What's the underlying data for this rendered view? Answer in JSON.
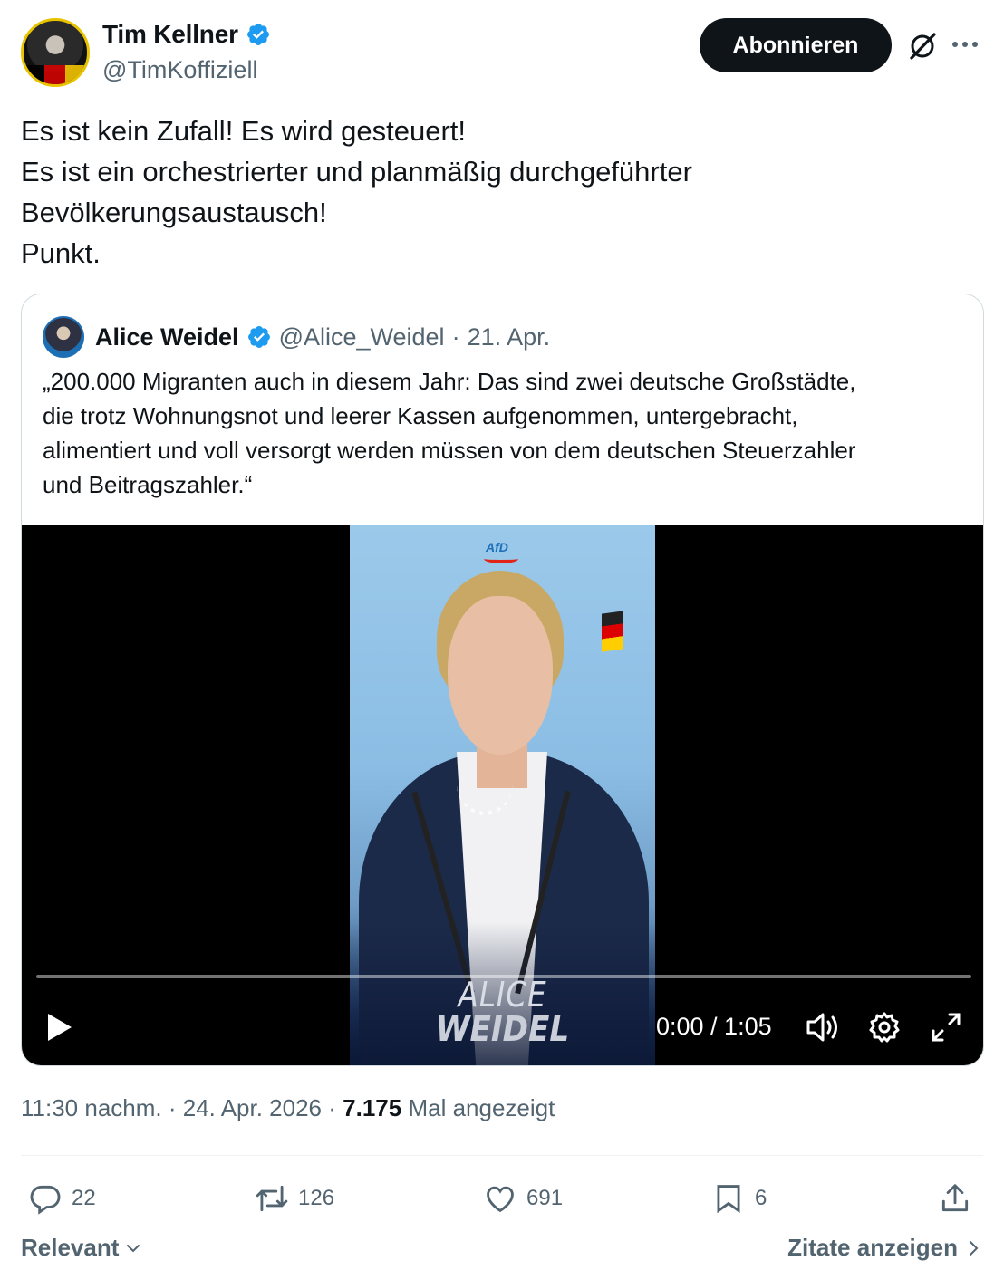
{
  "author": {
    "display_name": "Tim Kellner",
    "handle": "@TimKoffiziell",
    "follow_label": "Abonnieren"
  },
  "tweet": {
    "lines": [
      "Es ist kein Zufall! Es wird gesteuert!",
      "Es ist ein orchestrierter und planmäßig durchgeführter",
      "Bevölkerungsaustausch!",
      "Punkt."
    ]
  },
  "quote": {
    "display_name": "Alice Weidel",
    "handle": "@Alice_Weidel",
    "separator": "·",
    "date": "21. Apr.",
    "lines": [
      "„200.000 Migranten auch in diesem Jahr: Das sind zwei deutsche Großstädte,",
      "die trotz Wohnungsnot und leerer Kassen aufgenommen, untergebracht,",
      "alimentiert und voll versorgt werden müssen von dem deutschen Steuerzahler",
      "und Beitragszahler.“"
    ],
    "video": {
      "logo_text": "AfD",
      "caption_line1": "ALICE",
      "caption_line2": "WEIDEL",
      "time": "0:00 / 1:05",
      "progress": 0
    }
  },
  "meta": {
    "time": "11:30 nachm.",
    "date": "24. Apr. 2026",
    "separator": "·",
    "views_count": "7.175",
    "views_label": "Mal angezeigt"
  },
  "actions": {
    "replies": "22",
    "reposts": "126",
    "likes": "691",
    "bookmarks": "6"
  },
  "footer": {
    "sort_label": "Relevant",
    "quotes_label": "Zitate anzeigen"
  },
  "colors": {
    "verified": "#1d9bf0",
    "text_primary": "#0f1419",
    "text_secondary": "#536471",
    "border": "#cfd9de"
  },
  "icons": [
    "verified-badge-icon",
    "grok-icon",
    "more-icon",
    "play-icon",
    "volume-icon",
    "settings-gear-icon",
    "fullscreen-icon",
    "reply-icon",
    "repost-icon",
    "like-icon",
    "bookmark-icon",
    "share-icon",
    "chevron-down-icon",
    "chevron-right-icon"
  ]
}
